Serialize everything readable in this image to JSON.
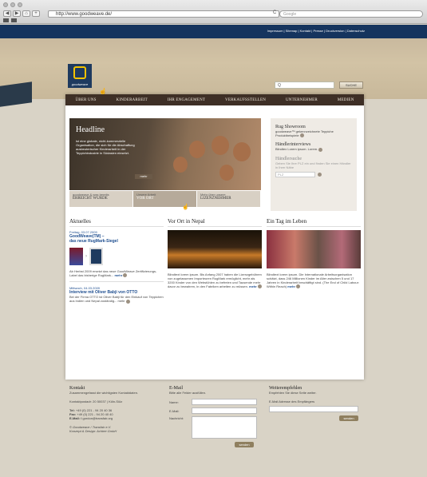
{
  "browser": {
    "url": "http://www.goodweave.de/",
    "search_placeholder": "Google",
    "reload": "C",
    "nav": [
      "◀",
      "▶",
      "⌂",
      "+"
    ]
  },
  "topbar": {
    "links": "Impressum | Sitemap | Kontakt | Presse | Druckversion | Datenschutz"
  },
  "header": {
    "logo_text": "goodweave",
    "search_value": "Q",
    "search_button": "SUCHE"
  },
  "nav": [
    "ÜBER UNS",
    "KINDERARBEIT",
    "IHR ENGAGEMENT",
    "VERKAUFSSTELLEN",
    "UNTERNEHMER",
    "MEDIEN"
  ],
  "hero": {
    "title": "Headline",
    "text": "ist eine globale, nicht-kommerzielle Organisation, die sich für die Abschaffung ausbeuterischer Kinderarbeit in der Teppichindustrie in Südasien einsetzt.",
    "more": "mehr"
  },
  "subtabs": [
    {
      "small": "goodweave & was bereits",
      "label": "ERREICHT WURDE"
    },
    {
      "small": "Unsere Arbeit",
      "label": "VOR ORT"
    },
    {
      "small": "Mehr über unsere",
      "label": "LIZENZNEHMER"
    }
  ],
  "right": {
    "rug_title": "Rug Showroom",
    "rug_text": "goodweave™ gekennzeichnete Teppiche Produktbeispiele",
    "haendler_title": "Händlerinterviews",
    "haendler_text": "Blindtex Lorem ipsum. Lorem.",
    "suche_title": "Händlersuche",
    "suche_text": "Geben Sie Ihre PLZ ein und finden Sie einen Händler in Ihrer Nähe",
    "plz_placeholder": "PLZ"
  },
  "aktuelles": {
    "title": "Aktuelles",
    "item1_date": "Freitag, 03.07.2009",
    "item1_title_1": "GoodWeave(TM) –",
    "item1_title_2": "das neue RugMark-Siegel",
    "item1_text": "Ab Herbst 2009 ersetzt das neue GoodWeave Zertifizierungs-Label das bisherige RugMark...",
    "more": "mehr",
    "item2_date": "Mittwoch, 04.03.2009",
    "item2_title": "Interview mit Oliver Babji von OTTO",
    "item2_text": "Bei der Firma OTTO ist Oliver Babji für den Einkauf von Teppichen aus Indien und Nepal zuständig... mehr"
  },
  "nepal": {
    "title": "Vor Ort in Nepal",
    "text": "Blindtext lorem ipsum. Bis Anfang 2007 haben die Lizenzgebühren von zugelassenen Importeuren RugMark ermöglicht, mehr als 3200 Kinder von den Webstühlen zu befreien und Tausende mehr davor zu bewahren, in den Fabriken arbeiten zu müssen.",
    "more": "mehr"
  },
  "tag": {
    "title": "Ein Tag im Leben",
    "text": "Blindtext lorem ipsum. Die Internationale Arbeitsorganisation schätzt, dass 246 Millionen Kinder im Alter zwischen 5 und 17 Jahren in Kinderarbeit beschäftigt sind. (The End of Child Labour: Within Reach)",
    "more": "mehr"
  },
  "footer": {
    "kontakt_title": "Kontakt",
    "kontakt_sub": "Zusammengefasst die wichtigsten Kontaktdaten.",
    "address": "Kontaktpostadr: 20 50037 | Köln-Sülz",
    "tel_label": "Tel:",
    "tel": "+49 (0) 221 - 94 20 40 36",
    "fax_label": "Fax:",
    "fax": "+49 (0) 221 - 94 20 40 40",
    "email_label": "E-Mail:",
    "email": "f.gordon@transfair.org",
    "credit1": "© Goodweave / Transfair e.V.",
    "credit2": "Konzept & Design: Achtee GmbH",
    "email_title": "E-Mail",
    "email_sub": "Bitte alle Felder ausfüllen.",
    "name_label": "Name:",
    "mail_label": "E-Mail:",
    "msg_label": "Nachricht:",
    "send": "senden",
    "weiter_title": "Weiterempfehlen",
    "weiter_sub": "Empfehlen Sie diese Seite weiter.",
    "weiter_label": "E-Mail Adresse des Empfängers"
  }
}
